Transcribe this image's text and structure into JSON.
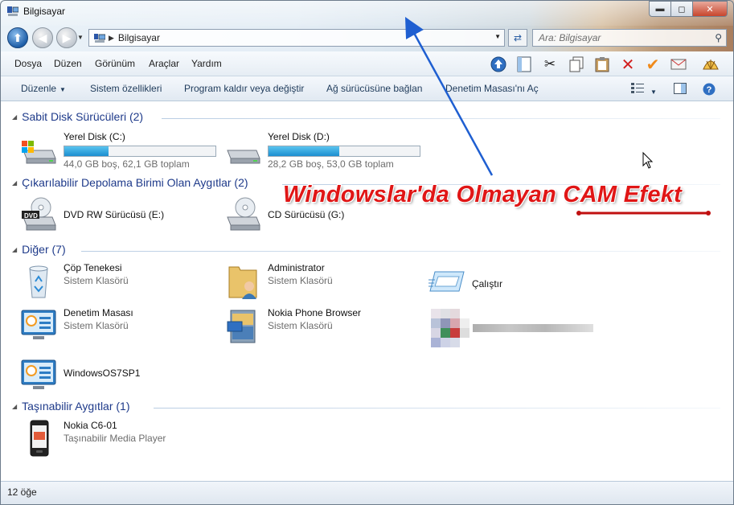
{
  "window": {
    "title": "Bilgisayar",
    "buttons": {
      "minimize": "▬",
      "maximize": "◻",
      "close": "✕"
    }
  },
  "address": {
    "text": "Bilgisayar",
    "separator": "▶"
  },
  "search": {
    "placeholder": "Ara: Bilgisayar"
  },
  "menu": {
    "items": [
      "Dosya",
      "Düzen",
      "Görünüm",
      "Araçlar",
      "Yardım"
    ]
  },
  "toolbar_icons": [
    "up-arrow-icon",
    "panel-icon",
    "cut-icon",
    "copy-icon",
    "paste-icon",
    "delete-icon",
    "checkmark-icon",
    "mail-icon",
    "shell-icon"
  ],
  "commandbar": {
    "organize": "Düzenle",
    "items": [
      "Sistem özellikleri",
      "Program kaldır veya değiştir",
      "Ağ sürücüsüne bağlan",
      "Denetim Masası'nı Aç"
    ]
  },
  "groups": {
    "hard_disks": {
      "header": "Sabit Disk Sürücüleri (2)",
      "drives": [
        {
          "name": "Yerel Disk (C:)",
          "caption": "44,0 GB boş, 62,1 GB toplam",
          "used_fraction": 0.29,
          "icon": "windows-drive-icon"
        },
        {
          "name": "Yerel Disk (D:)",
          "caption": "28,2 GB boş, 53,0 GB toplam",
          "used_fraction": 0.47,
          "icon": "drive-icon"
        }
      ]
    },
    "removable": {
      "header": "Çıkarılabilir Depolama Birimi Olan Aygıtlar (2)",
      "items": [
        {
          "name": "DVD RW Sürücüsü (E:)",
          "icon": "dvd-drive-icon",
          "badge": "DVD"
        },
        {
          "name": "CD Sürücüsü (G:)",
          "icon": "cd-drive-icon"
        }
      ]
    },
    "other": {
      "header": "Diğer (7)",
      "items": [
        {
          "name": "Çöp Tenekesi",
          "sub": "Sistem Klasörü",
          "icon": "recycle-bin-icon"
        },
        {
          "name": "Administrator",
          "sub": "Sistem Klasörü",
          "icon": "user-folder-icon"
        },
        {
          "name": "Çalıştır",
          "sub": "",
          "icon": "run-icon"
        },
        {
          "name": "Denetim Masası",
          "sub": "Sistem Klasörü",
          "icon": "control-panel-icon"
        },
        {
          "name": "Nokia Phone Browser",
          "sub": "Sistem Klasörü",
          "icon": "phone-browser-icon"
        },
        {
          "name": "WindowsOS7SP1",
          "sub": "",
          "icon": "control-panel-icon"
        }
      ]
    },
    "portable": {
      "header": "Taşınabilir Aygıtlar (1)",
      "items": [
        {
          "name": "Nokia C6-01",
          "sub": "Taşınabilir Media Player",
          "icon": "nokia-phone-icon"
        }
      ]
    }
  },
  "status": {
    "text": "12 öğe"
  },
  "annotation": {
    "text": "Windowslar'da Olmayan CAM Efekt"
  },
  "colors": {
    "accent": "#1e3a8a",
    "annotation": "#e01616",
    "arrow": "#1f5fd1",
    "bar_fill": "#1c8fd0"
  }
}
